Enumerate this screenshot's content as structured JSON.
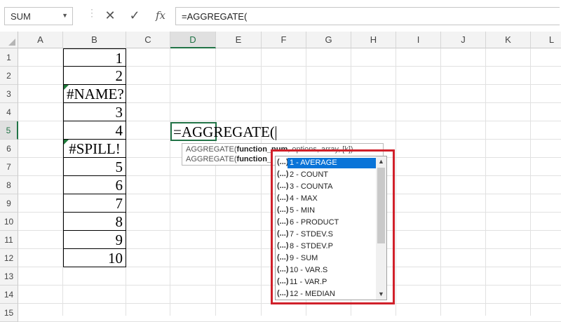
{
  "formula_bar": {
    "name_box": "SUM",
    "cancel_icon": "✕",
    "enter_icon": "✓",
    "fx_label": "fx",
    "formula": "=AGGREGATE("
  },
  "columns": [
    "A",
    "B",
    "C",
    "D",
    "E",
    "F",
    "G",
    "H",
    "I",
    "J",
    "K",
    "L"
  ],
  "rows": [
    "1",
    "2",
    "3",
    "4",
    "5",
    "6",
    "7",
    "8",
    "9",
    "10",
    "11",
    "12",
    "13",
    "14",
    "15"
  ],
  "active": {
    "column": "D",
    "row": "5",
    "text": "=AGGREGATE("
  },
  "column_b": [
    {
      "row": "1",
      "value": "1",
      "kind": "num"
    },
    {
      "row": "2",
      "value": "2",
      "kind": "num"
    },
    {
      "row": "3",
      "value": "#NAME?",
      "kind": "err"
    },
    {
      "row": "4",
      "value": "3",
      "kind": "num"
    },
    {
      "row": "5",
      "value": "4",
      "kind": "num"
    },
    {
      "row": "6",
      "value": "#SPILL!",
      "kind": "err"
    },
    {
      "row": "7",
      "value": "5",
      "kind": "num"
    },
    {
      "row": "8",
      "value": "6",
      "kind": "num"
    },
    {
      "row": "9",
      "value": "7",
      "kind": "num"
    },
    {
      "row": "10",
      "value": "8",
      "kind": "num"
    },
    {
      "row": "11",
      "value": "9",
      "kind": "num"
    },
    {
      "row": "12",
      "value": "10",
      "kind": "num"
    }
  ],
  "tooltip": {
    "line1_prefix": "AGGREGATE(",
    "line1_bold": "function_num",
    "line1_suffix": ", options, array, [k])",
    "line2_prefix": "AGGREGATE(",
    "line2_bold": "function_"
  },
  "autocomplete": {
    "icon": "(...)",
    "items": [
      "1 - AVERAGE",
      "2 - COUNT",
      "3 - COUNTA",
      "4 - MAX",
      "5 - MIN",
      "6 - PRODUCT",
      "7 - STDEV.S",
      "8 - STDEV.P",
      "9 - SUM",
      "10 - VAR.S",
      "11 - VAR.P",
      "12 - MEDIAN"
    ],
    "selected_index": 0,
    "scroll_up": "▲",
    "scroll_down": "▼"
  },
  "colors": {
    "accent": "#217346",
    "highlight_outline": "#d0202a",
    "selection": "#0a74d8"
  }
}
